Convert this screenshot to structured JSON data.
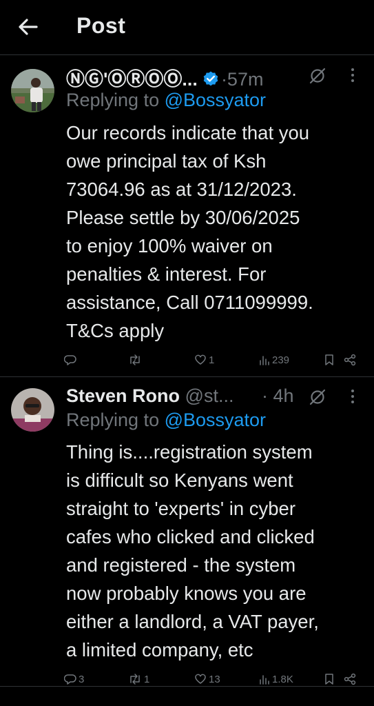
{
  "header": {
    "title": "Post"
  },
  "posts": [
    {
      "author": "ⓃⒼ'ⓄⓇⓄⓄ...",
      "handle": "",
      "time": "·57m",
      "verified": true,
      "replying_prefix": "Replying to ",
      "replying_handle": "@Bossyator",
      "lines": [
        "Our records indicate that you",
        "owe principal tax of Ksh",
        "73064.96 as at 31/12/2023.",
        "Please settle by 30/06/2025",
        "to enjoy 100% waiver on",
        "penalties & interest. For",
        "assistance, Call 0711099999.",
        "T&Cs apply"
      ],
      "replies": "",
      "reposts": "",
      "likes": "1",
      "views": "239"
    },
    {
      "author": "Steven Rono",
      "handle": "@st...",
      "time": "· 4h",
      "verified": false,
      "replying_prefix": "Replying to ",
      "replying_handle": "@Bossyator",
      "lines": [
        "Thing is....registration system",
        "is difficult so Kenyans went",
        "straight to 'experts' in cyber",
        "cafes who clicked and clicked",
        "and registered - the system",
        "now probably knows you are",
        "either a landlord, a VAT payer,",
        "a limited company, etc"
      ],
      "replies": "3",
      "reposts": "1",
      "likes": "13",
      "views": "1.8K"
    }
  ],
  "icons": {
    "back": "arrow-left-icon",
    "verified": "verified-badge-icon",
    "grok": "grok-icon",
    "more": "more-icon",
    "reply": "reply-icon",
    "repost": "repost-icon",
    "like": "heart-icon",
    "views": "views-icon",
    "bookmark": "bookmark-icon",
    "share": "share-icon"
  },
  "colors": {
    "accent": "#1d9bf0",
    "muted": "#71767b",
    "text": "#e7e9ea",
    "background": "#000000"
  }
}
